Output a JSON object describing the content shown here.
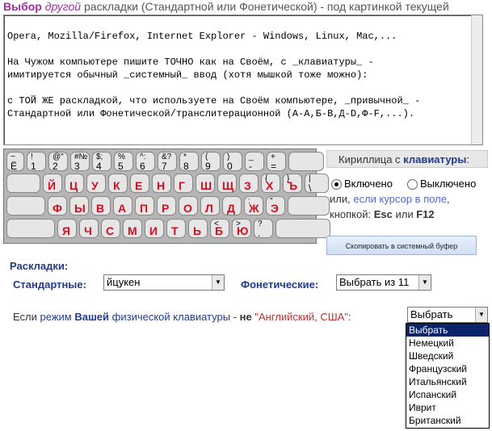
{
  "header": {
    "part1": "Выбор",
    "part2": "другой",
    "part3": "раскладки (Стандартной или Фонетической) - под картинкой текущей"
  },
  "textarea": {
    "lines": [
      "Opera, Mozilla/Firefox, Internet Explorer - Windows, Linux, Mac,...",
      "",
      "На Чужом компьютере пишите ТОЧНО как на Своём, с _клавиатуры_ -",
      "имитируется обычный _системный_ ввод (хотя мышкой тоже можно):",
      "",
      "с ТОЙ ЖЕ раскладкой, что используете на Своём компьютере, _привычной_ -",
      "Стандартной или Фонетической/транслитерационной (А-А,Б-В,Д-D,Ф-F,...)."
    ]
  },
  "keyboard": {
    "row1": [
      {
        "t": "~",
        "m": "",
        "n": "Ё"
      },
      {
        "t": "!",
        "m": "",
        "n": "1"
      },
      {
        "t": "@\"",
        "m": "",
        "n": "2"
      },
      {
        "t": "#№",
        "m": "",
        "n": "3"
      },
      {
        "t": "$;",
        "m": "",
        "n": "4"
      },
      {
        "t": "%",
        "m": "",
        "n": "5"
      },
      {
        "t": "^:",
        "m": "",
        "n": "6"
      },
      {
        "t": "&?",
        "m": "",
        "n": "7"
      },
      {
        "t": "*",
        "m": "",
        "n": "8"
      },
      {
        "t": "(",
        "m": "",
        "n": "9"
      },
      {
        "t": ")",
        "m": "",
        "n": "0"
      },
      {
        "t": "_",
        "m": "",
        "n": "-"
      },
      {
        "t": "+",
        "m": "",
        "n": "="
      },
      {
        "t": "",
        "m": "",
        "n": ""
      }
    ],
    "row2": [
      {
        "t": "",
        "m": "",
        "n": ""
      },
      {
        "t": "",
        "m": "Й",
        "n": ""
      },
      {
        "t": "",
        "m": "Ц",
        "n": ""
      },
      {
        "t": "",
        "m": "У",
        "n": ""
      },
      {
        "t": "",
        "m": "К",
        "n": ""
      },
      {
        "t": "",
        "m": "Е",
        "n": ""
      },
      {
        "t": "",
        "m": "Н",
        "n": ""
      },
      {
        "t": "",
        "m": "Г",
        "n": ""
      },
      {
        "t": "",
        "m": "Ш",
        "n": ""
      },
      {
        "t": "",
        "m": "Щ",
        "n": ""
      },
      {
        "t": "",
        "m": "З",
        "n": ""
      },
      {
        "t": "{",
        "m": "Х",
        "n": ""
      },
      {
        "t": "}",
        "m": "Ъ",
        "n": ""
      },
      {
        "t": "|",
        "m": "",
        "n": "\\"
      }
    ],
    "row3": [
      {
        "t": "",
        "m": "",
        "n": ""
      },
      {
        "t": "",
        "m": "Ф",
        "n": ""
      },
      {
        "t": "",
        "m": "Ы",
        "n": ""
      },
      {
        "t": "",
        "m": "В",
        "n": ""
      },
      {
        "t": "",
        "m": "А",
        "n": ""
      },
      {
        "t": "",
        "m": "П",
        "n": ""
      },
      {
        "t": "",
        "m": "Р",
        "n": ""
      },
      {
        "t": "",
        "m": "О",
        "n": ""
      },
      {
        "t": "",
        "m": "Л",
        "n": ""
      },
      {
        "t": "",
        "m": "Д",
        "n": ""
      },
      {
        "t": ":",
        "m": "Ж",
        "n": ""
      },
      {
        "t": "\"",
        "m": "Э",
        "n": ""
      },
      {
        "t": "",
        "m": "",
        "n": ""
      }
    ],
    "row4": [
      {
        "t": "",
        "m": "",
        "n": ""
      },
      {
        "t": "",
        "m": "Я",
        "n": ""
      },
      {
        "t": "",
        "m": "Ч",
        "n": ""
      },
      {
        "t": "",
        "m": "С",
        "n": ""
      },
      {
        "t": "",
        "m": "М",
        "n": ""
      },
      {
        "t": "",
        "m": "И",
        "n": ""
      },
      {
        "t": "",
        "m": "Т",
        "n": ""
      },
      {
        "t": "",
        "m": "Ь",
        "n": ""
      },
      {
        "t": "<",
        "m": "Б",
        "n": ""
      },
      {
        "t": ">",
        "m": "Ю",
        "n": ""
      },
      {
        "t": "?",
        "m": "",
        "n": "."
      },
      {
        "t": "",
        "m": "",
        "n": ""
      }
    ]
  },
  "panel": {
    "title_prefix": "Кириллица с",
    "title_bold": "клавиатуры",
    "title_colon": ":",
    "option_on": "Включено",
    "option_off": "Выключено",
    "line2_prefix": "или,",
    "line2_link": "если курсор в поле",
    "line2_comma": ",",
    "line3_prefix": "кнопкой:",
    "key1": "Esc",
    "line3_or": "или",
    "key2": "F12"
  },
  "copy_button": "Скопировать в системный буфер",
  "layouts": {
    "heading": "Раскладки:",
    "standard_label": "Стандартные:",
    "standard_value": "йцукен",
    "phonetic_label": "Фонетические:",
    "phonetic_value": "Выбрать из 11"
  },
  "bottom": {
    "prefix": "Если",
    "link_a": "режим",
    "link_b": "Вашей",
    "link_c": "физической клавиатуры",
    "dash": "-",
    "ne": "не",
    "quoted": "\"Английский, США\"",
    "colon": ":"
  },
  "dropdown": {
    "value": "Выбрать",
    "options": [
      "Выбрать",
      "Немецкий",
      "Шведский",
      "Французский",
      "Итальянский",
      "Испанский",
      "Иврит",
      "Британский"
    ]
  },
  "colors": {
    "accent": "#223b8a",
    "header_purple": "#a0309a",
    "key_red": "#d01020"
  }
}
